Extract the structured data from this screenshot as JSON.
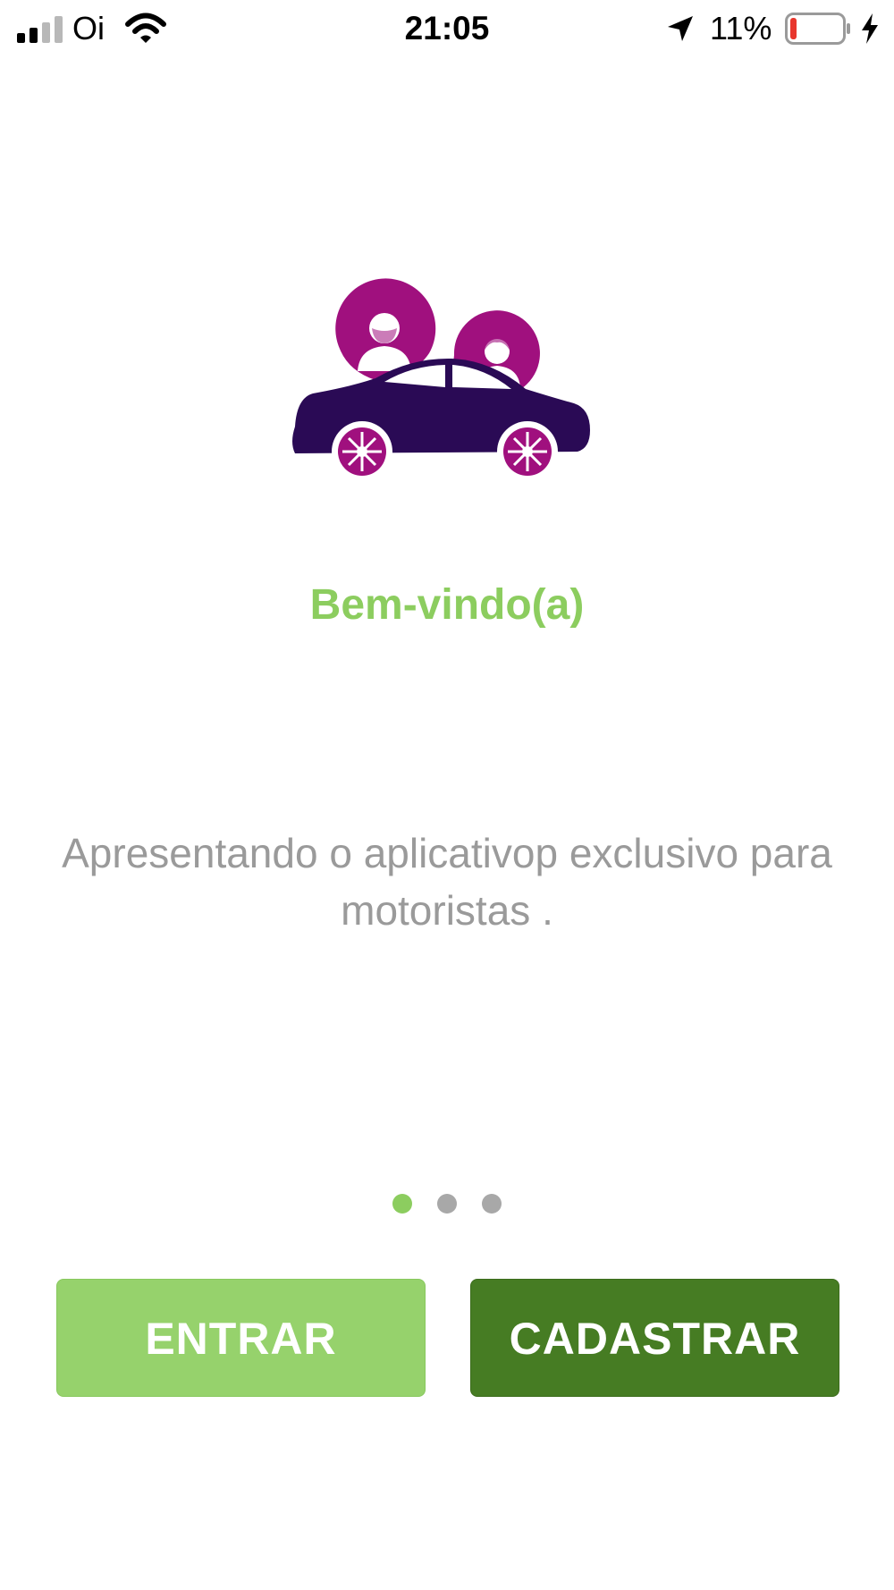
{
  "status_bar": {
    "carrier": "Oi",
    "time": "21:05",
    "battery_percent": "11%",
    "battery_level": 0.11,
    "signal_bars": 2,
    "signal_bars_max": 4
  },
  "illustration": {
    "icon": "car-with-chat-bubbles-icon",
    "car_color": "#2a0a55",
    "accent_color": "#a0107e"
  },
  "welcome": {
    "title": "Bem-vindo(a)",
    "description": "Apresentando o aplicativop exclusivo para motoristas ."
  },
  "pager": {
    "total": 3,
    "current": 1,
    "active_color": "#8ccd5f",
    "inactive_color": "#a8a8a8"
  },
  "actions": {
    "login_label": "ENTRAR",
    "register_label": "CADASTRAR"
  }
}
